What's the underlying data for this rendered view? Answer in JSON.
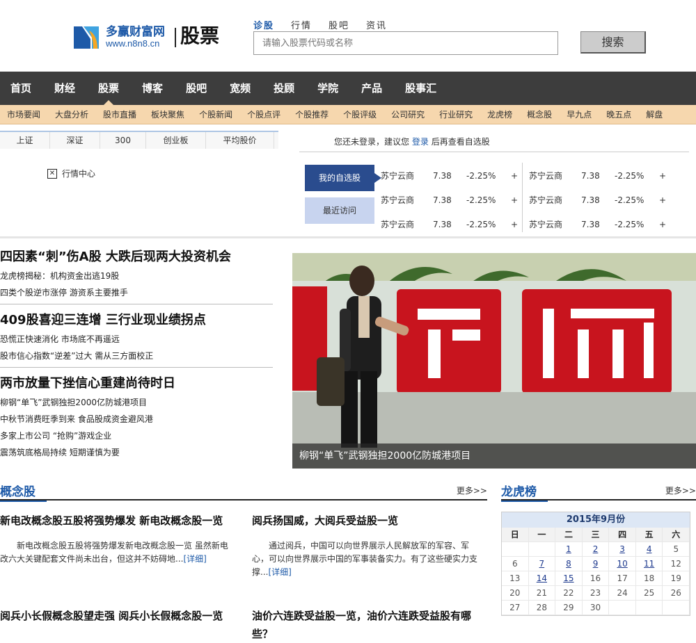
{
  "brand": {
    "name": "多赢财富网",
    "url": "www.n8n8.cn",
    "section": "股票"
  },
  "search": {
    "tabs": [
      "诊股",
      "行情",
      "股吧",
      "资讯"
    ],
    "placeholder": "请输入股票代码或名称",
    "button": "搜索"
  },
  "main_nav": [
    "首页",
    "财经",
    "股票",
    "博客",
    "股吧",
    "宽频",
    "投顾",
    "学院",
    "产品",
    "股事汇"
  ],
  "sub_nav": [
    "市场要闻",
    "大盘分析",
    "股市直播",
    "板块聚焦",
    "个股新闻",
    "个股点评",
    "个股推荐",
    "个股评级",
    "公司研究",
    "行业研究",
    "龙虎榜",
    "概念股",
    "早九点",
    "晚五点",
    "解盘"
  ],
  "index_tabs": [
    "上证",
    "深证",
    "300",
    "创业板",
    "平均股价"
  ],
  "market_center": "行情中心",
  "login_note": {
    "pre": "您还未登录，建议您",
    "link": "登录",
    "post": "后再查看自选股"
  },
  "watch_buttons": {
    "mine": "我的自选股",
    "recent": "最近访问"
  },
  "stocks": [
    {
      "name": "苏宁云商",
      "price": "7.38",
      "change": "-2.25%",
      "add": "+"
    },
    {
      "name": "苏宁云商",
      "price": "7.38",
      "change": "-2.25%",
      "add": "+"
    },
    {
      "name": "苏宁云商",
      "price": "7.38",
      "change": "-2.25%",
      "add": "+"
    },
    {
      "name": "苏宁云商",
      "price": "7.38",
      "change": "-2.25%",
      "add": "+"
    },
    {
      "name": "苏宁云商",
      "price": "7.38",
      "change": "-2.25%",
      "add": "+"
    },
    {
      "name": "苏宁云商",
      "price": "7.38",
      "change": "-2.25%",
      "add": "+"
    }
  ],
  "news": [
    {
      "headline": "四因素“刺”伤A股 大跌后现两大投资机会",
      "lines": [
        "龙虎榜揭秘：机构资金出逃19股",
        "四类个股逆市涨停 游资系主要推手"
      ]
    },
    {
      "headline": "409股喜迎三连增 三行业现业绩拐点",
      "lines": [
        "恐慌正快速消化 市场底不再遥远",
        "股市信心指数“逆差”过大 需从三方面校正"
      ]
    },
    {
      "headline": "两市放量下挫信心重建尚待时日",
      "lines": [
        "柳钢“单飞”武钢独担2000亿防城港项目",
        "中秋节消费旺季到来 食品股成资金避风港",
        "多家上市公司 “抢购”游戏企业",
        "震荡筑底格局持续 短期谨慎为要"
      ]
    }
  ],
  "hero": {
    "caption": "柳钢“单飞”武钢独担2000亿防城港项目",
    "sign_text": "武钢"
  },
  "concept": {
    "title": "概念股",
    "more": "更多>>",
    "articles": [
      {
        "title": "新电改概念股五股将强势爆发 新电改概念股一览",
        "body": "新电改概念股五股将强势爆发新电改概念股一览 虽然新电改六大关键配套文件尚未出台，但这并不妨碍地...",
        "more": "[详细]"
      },
      {
        "title": "阅兵扬国威，大阅兵受益股一览",
        "body": "通过阅兵，中国可以向世界展示人民解放军的军容、军心，可以向世界展示中国的军事装备实力。有了这些硬实力支撑...",
        "more": "[详细]"
      },
      {
        "title": "阅兵小长假概念股望走强 阅兵小长假概念股一览",
        "body": "",
        "more": ""
      },
      {
        "title": "油价六连跌受益股一览，油价六连跌受益股有哪些？",
        "body": "",
        "more": ""
      }
    ]
  },
  "dragon": {
    "title": "龙虎榜",
    "more": "更多>>",
    "calendar": {
      "title": "2015年9月份",
      "weekdays": [
        "日",
        "一",
        "二",
        "三",
        "四",
        "五",
        "六"
      ],
      "weeks": [
        [
          "",
          "",
          "1",
          "2",
          "3",
          "4",
          "5"
        ],
        [
          "6",
          "7",
          "8",
          "9",
          "10",
          "11",
          "12"
        ],
        [
          "13",
          "14",
          "15",
          "16",
          "17",
          "18",
          "19"
        ],
        [
          "20",
          "21",
          "22",
          "23",
          "24",
          "25",
          "26"
        ],
        [
          "27",
          "28",
          "29",
          "30",
          "",
          "",
          ""
        ]
      ],
      "linked_days": [
        "1",
        "2",
        "3",
        "4",
        "7",
        "8",
        "9",
        "10",
        "11",
        "14",
        "15"
      ],
      "weekend_color": "#d40000",
      "link_color": "#1e3a8e"
    }
  },
  "colors": {
    "accent": "#1e5aa8",
    "nav_bg": "#3d3d3d",
    "subnav_bg": "#f6d7ae",
    "watch_active": "#2a4c8e",
    "watch_inactive": "#c8d4ef"
  }
}
